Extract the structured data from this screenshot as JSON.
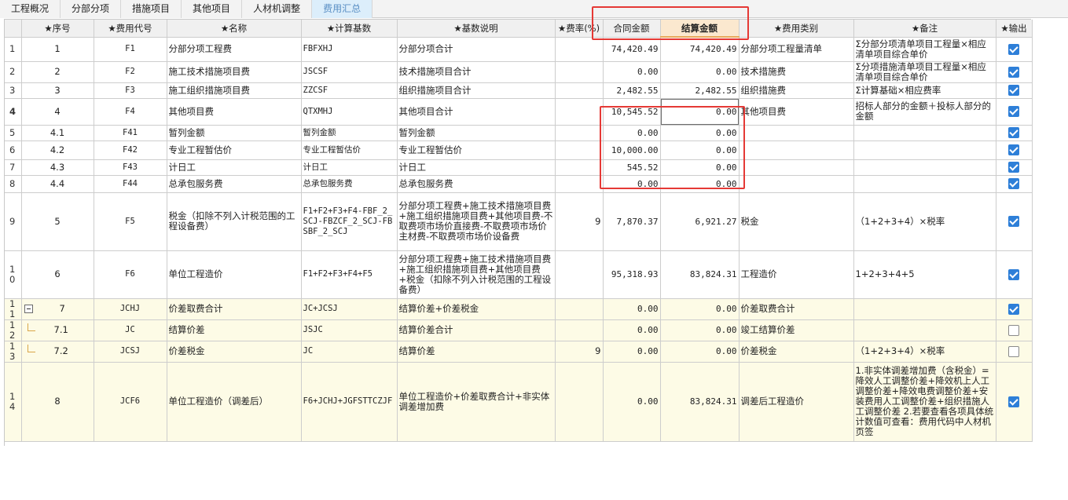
{
  "tabs": [
    {
      "label": "工程概况",
      "active": false
    },
    {
      "label": "分部分项",
      "active": false
    },
    {
      "label": "措施项目",
      "active": false
    },
    {
      "label": "其他项目",
      "active": false
    },
    {
      "label": "人材机调整",
      "active": false
    },
    {
      "label": "费用汇总",
      "active": true
    }
  ],
  "columns": {
    "row_no": "",
    "seq": "★序号",
    "code": "★费用代号",
    "name": "★名称",
    "base": "★计算基数",
    "desc": "★基数说明",
    "rate": "★费率(%)",
    "contract": "合同金额",
    "settle": "结算金额",
    "category": "★费用类别",
    "note": "★备注",
    "output": "★输出"
  },
  "rows": [
    {
      "no": "1",
      "seq": "1",
      "code": "F1",
      "name": "分部分项工程费",
      "base": "FBFXHJ",
      "desc": "分部分项合计",
      "rate": "",
      "contract": "74,420.49",
      "settle": "74,420.49",
      "category": "分部分项工程量清单",
      "note": "Σ分部分项清单项目工程量×相应清单项目综合单价",
      "output": true
    },
    {
      "no": "2",
      "seq": "2",
      "code": "F2",
      "name": "施工技术措施项目费",
      "base": "JSCSF",
      "desc": "技术措施项目合计",
      "rate": "",
      "contract": "0.00",
      "settle": "0.00",
      "category": "技术措施费",
      "note": "Σ分项措施清单项目工程量×相应清单项目综合单价",
      "output": true
    },
    {
      "no": "3",
      "seq": "3",
      "code": "F3",
      "name": "施工组织措施项目费",
      "base": "ZZCSF",
      "desc": "组织措施项目合计",
      "rate": "",
      "contract": "2,482.55",
      "settle": "2,482.55",
      "category": "组织措施费",
      "note": "Σ计算基础×相应费率",
      "output": true
    },
    {
      "no": "4",
      "seq": "4",
      "code": "F4",
      "name": "其他项目费",
      "base": "QTXMHJ",
      "desc": "其他项目合计",
      "rate": "",
      "contract": "10,545.52",
      "settle": "0.00",
      "category": "其他项目费",
      "note": "招标人部分的金额＋投标人部分的金额",
      "output": true
    },
    {
      "no": "5",
      "seq": "4.1",
      "code": "F41",
      "name": "暂列金额",
      "base": "暂列金额",
      "desc": "暂列金额",
      "rate": "",
      "contract": "0.00",
      "settle": "0.00",
      "category": "",
      "note": "",
      "output": true
    },
    {
      "no": "6",
      "seq": "4.2",
      "code": "F42",
      "name": "专业工程暂估价",
      "base": "专业工程暂估价",
      "desc": "专业工程暂估价",
      "rate": "",
      "contract": "10,000.00",
      "settle": "0.00",
      "category": "",
      "note": "",
      "output": true
    },
    {
      "no": "7",
      "seq": "4.3",
      "code": "F43",
      "name": "计日工",
      "base": "计日工",
      "desc": "计日工",
      "rate": "",
      "contract": "545.52",
      "settle": "0.00",
      "category": "",
      "note": "",
      "output": true
    },
    {
      "no": "8",
      "seq": "4.4",
      "code": "F44",
      "name": "总承包服务费",
      "base": "总承包服务费",
      "desc": "总承包服务费",
      "rate": "",
      "contract": "0.00",
      "settle": "0.00",
      "category": "",
      "note": "",
      "output": true
    },
    {
      "no": "9",
      "seq": "5",
      "code": "F5",
      "name": "税金（扣除不列入计税范围的工程设备费）",
      "base": "F1+F2+F3+F4-FBF_2_SCJ-FBZCF_2_SCJ-FBSBF_2_SCJ",
      "desc": "分部分项工程费+施工技术措施项目费+施工组织措施项目费+其他项目费-不取费项市场价直接费-不取费项市场价主材费-不取费项市场价设备费",
      "rate": "9",
      "contract": "7,870.37",
      "settle": "6,921.27",
      "category": "税金",
      "note": "（1+2+3+4）×税率",
      "output": true
    },
    {
      "no": "10",
      "seq": "6",
      "code": "F6",
      "name": "单位工程造价",
      "base": "F1+F2+F3+F4+F5",
      "desc": "分部分项工程费+施工技术措施项目费+施工组织措施项目费+其他项目费+税金（扣除不列入计税范围的工程设备费）",
      "rate": "",
      "contract": "95,318.93",
      "settle": "83,824.31",
      "category": "工程造价",
      "note": "1+2+3+4+5",
      "output": true
    },
    {
      "no": "11",
      "seq": "7",
      "code": "JCHJ",
      "name": "价差取费合计",
      "base": "JC+JCSJ",
      "desc": "结算价差+价差税金",
      "rate": "",
      "contract": "0.00",
      "settle": "0.00",
      "category": "价差取费合计",
      "note": "",
      "output": true
    },
    {
      "no": "12",
      "seq": "7.1",
      "code": "JC",
      "name": "结算价差",
      "base": "JSJC",
      "desc": "结算价差合计",
      "rate": "",
      "contract": "0.00",
      "settle": "0.00",
      "category": "竣工结算价差",
      "note": "",
      "output": false
    },
    {
      "no": "13",
      "seq": "7.2",
      "code": "JCSJ",
      "name": "价差税金",
      "base": "JC",
      "desc": "结算价差",
      "rate": "9",
      "contract": "0.00",
      "settle": "0.00",
      "category": "价差税金",
      "note": "（1+2+3+4）×税率",
      "output": false
    },
    {
      "no": "14",
      "seq": "8",
      "code": "JCF6",
      "name": "单位工程造价（调差后）",
      "base": "F6+JCHJ+JGFSTTCZJF",
      "desc": "单位工程造价+价差取费合计+非实体调差增加费",
      "rate": "",
      "contract": "0.00",
      "settle": "83,824.31",
      "category": "调差后工程造价",
      "note": "1.非实体调差增加费（含税金）=降效人工调整价差+降效机上人工调整价差+降效电费调整价差+安装费用人工调整价差+组织措施人工调整价差\n2.若要查看各项具体统计数值可查看：费用代码中人材机页签",
      "output": true
    }
  ]
}
